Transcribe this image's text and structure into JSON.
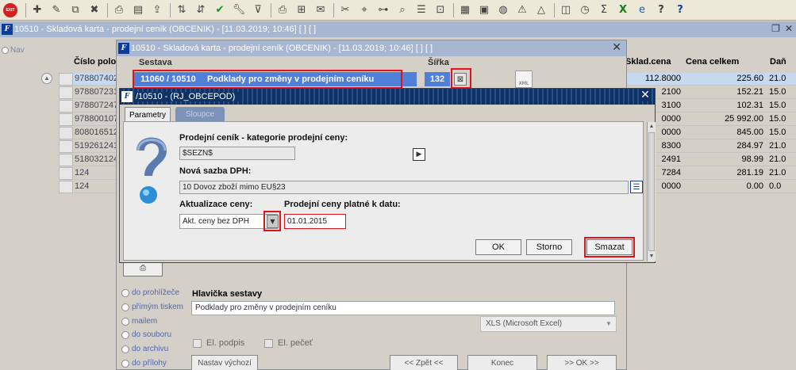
{
  "toolbar": {
    "exit_label": "EXIT",
    "icons": [
      "scissors-icon",
      "pin-icon",
      "checkmark-icon",
      "wrench-icon",
      "filter-icon"
    ]
  },
  "main_window": {
    "title": "10510 - Skladová karta - prodejní ceník (OBCENIK) - [11.03.2019; 10:46]  [ ]  [ ]",
    "nav_label": "Nav"
  },
  "table": {
    "columns": {
      "code": "Číslo polo",
      "sklad_cena": "Sklad.cena",
      "cena_celkem": "Cena celkem",
      "dan": "Daň"
    },
    "rows": [
      {
        "code": "978807402",
        "sklad": "112.8000",
        "celkem": "225.60",
        "dan": "21.0"
      },
      {
        "code": "978807231",
        "sklad": "2100",
        "celkem": "152.21",
        "dan": "15.0"
      },
      {
        "code": "978807247",
        "sklad": "3100",
        "celkem": "102.31",
        "dan": "15.0"
      },
      {
        "code": "978800107",
        "sklad": "0000",
        "celkem": "25 992.00",
        "dan": "15.0"
      },
      {
        "code": "808016512",
        "sklad": "0000",
        "celkem": "845.00",
        "dan": "15.0"
      },
      {
        "code": "519261241",
        "sklad": "8300",
        "celkem": "284.97",
        "dan": "21.0"
      },
      {
        "code": "518032124",
        "sklad": "2491",
        "celkem": "98.99",
        "dan": "21.0"
      },
      {
        "code": "124",
        "sklad": "7284",
        "celkem": "281.19",
        "dan": "21.0"
      },
      {
        "code": "124",
        "sklad": "0000",
        "celkem": "0.00",
        "dan": "0.0"
      }
    ]
  },
  "sestava_dialog": {
    "title": "10510 - Skladová karta - prodejní ceník (OBCENIK) - [11.03.2019; 10:46]  [ ]  [ ]",
    "col_sestava": "Sestava",
    "col_sirka": "Šířka",
    "sestava_code": "11060 / 10510",
    "sestava_name": "Podklady pro změny v prodejním ceníku",
    "sirka_value": "132",
    "xml_label": "XML",
    "output_options": [
      "do prohlížeče",
      "přímým tiskem",
      "mailem",
      "do souboru",
      "do archivu",
      "do přílohy"
    ],
    "hlavicka_label": "Hlavička sestavy",
    "hlavicka_value": "Podklady pro změny v prodejním ceníku",
    "format_value": "XLS (Microsoft Excel)",
    "el_podpis": "El. podpis",
    "el_pecet": "El. pečeť",
    "btn_nastav": "Nastav výchozí",
    "btn_zpet": "<< Zpět <<",
    "btn_konec": "Konec",
    "btn_ok": ">> OK >>"
  },
  "param_dialog": {
    "title": "/10510 - (RJ_OBCEPOD)",
    "tab_parametry": "Parametry",
    "tab_sloupce": "Sloupce",
    "label_cenik": "Prodejní ceník - kategorie prodejní ceny:",
    "value_cenik": "$SEZN$",
    "label_dph": "Nová sazba DPH:",
    "value_dph": "10  Dovoz zboží mimo EU§23",
    "label_aktualizace": "Aktualizace ceny:",
    "value_aktualizace": "Akt. ceny bez DPH",
    "label_datum": "Prodejní ceny platné k datu:",
    "value_datum": "01.01.2015",
    "btn_ok": "OK",
    "btn_storno": "Storno",
    "btn_smazat": "Smazat"
  },
  "colors": {
    "title_active": "#0f3266",
    "title_inactive": "#a7b6d1",
    "selection_blue": "#4f7fd6",
    "highlight_red": "#e0121b"
  }
}
